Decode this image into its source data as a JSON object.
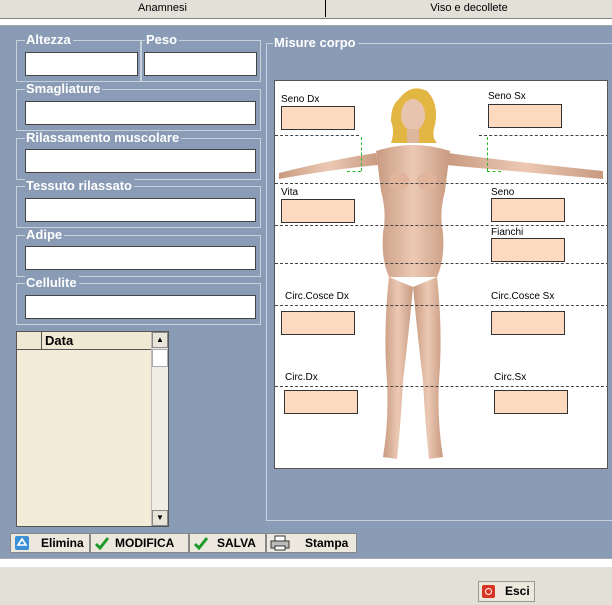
{
  "tabs": [
    {
      "label": "Anamnesi"
    },
    {
      "label": "Viso e decollete"
    }
  ],
  "fields": {
    "altezza": {
      "label": "Altezza",
      "value": ""
    },
    "peso": {
      "label": "Peso",
      "value": ""
    },
    "smagliature": {
      "label": "Smagliature",
      "value": ""
    },
    "rilassamento": {
      "label": "Rilassamento muscolare",
      "value": ""
    },
    "tessuto": {
      "label": "Tessuto rilassato",
      "value": ""
    },
    "adipe": {
      "label": "Adipe",
      "value": ""
    },
    "cellulite": {
      "label": "Cellulite",
      "value": ""
    }
  },
  "grid": {
    "column_header": "Data",
    "rows": []
  },
  "buttons": {
    "elimina": "Elimina",
    "modifica": "MODIFICA",
    "salva": "SALVA",
    "stampa": "Stampa",
    "esci": "Esci"
  },
  "measures": {
    "title": "Misure corpo",
    "seno_dx": "Seno Dx",
    "seno_sx": "Seno Sx",
    "vita": "Vita",
    "seno": "Seno",
    "fianchi": "Fianchi",
    "circ_cosce_dx": "Circ.Cosce Dx",
    "circ_cosce_sx": "Circ.Cosce Sx",
    "circ_dx": "Circ.Dx",
    "circ_sx": "Circ.Sx"
  },
  "colors": {
    "background": "#8a9bb6",
    "measure_field": "#fcd9bf",
    "accent_green": "#28b828"
  }
}
